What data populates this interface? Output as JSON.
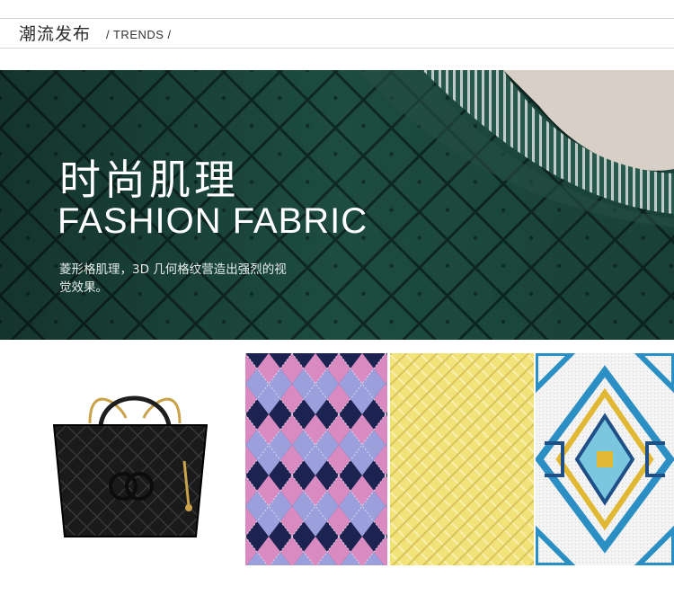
{
  "header": {
    "title_cn": "潮流发布",
    "title_en": "/ TRENDS /"
  },
  "hero": {
    "title_cn": "时尚肌理",
    "title_en": "FASHION FABRIC",
    "description": "菱形格肌理，3D 几何格纹营造出强烈的视觉效果。"
  },
  "gallery": {
    "items": [
      {
        "name": "quilted-handbag"
      },
      {
        "name": "argyle-pattern"
      },
      {
        "name": "yellow-lattice-pattern"
      },
      {
        "name": "cross-stitch-pattern"
      }
    ]
  },
  "colors": {
    "knit_green": "#1d4b40",
    "argyle_navy": "#1c2350",
    "argyle_pink": "#d98bc1",
    "argyle_lilac": "#9b9fdc",
    "lattice_yellow": "#f2e27a",
    "embroidery_blue": "#2c8fc4"
  }
}
